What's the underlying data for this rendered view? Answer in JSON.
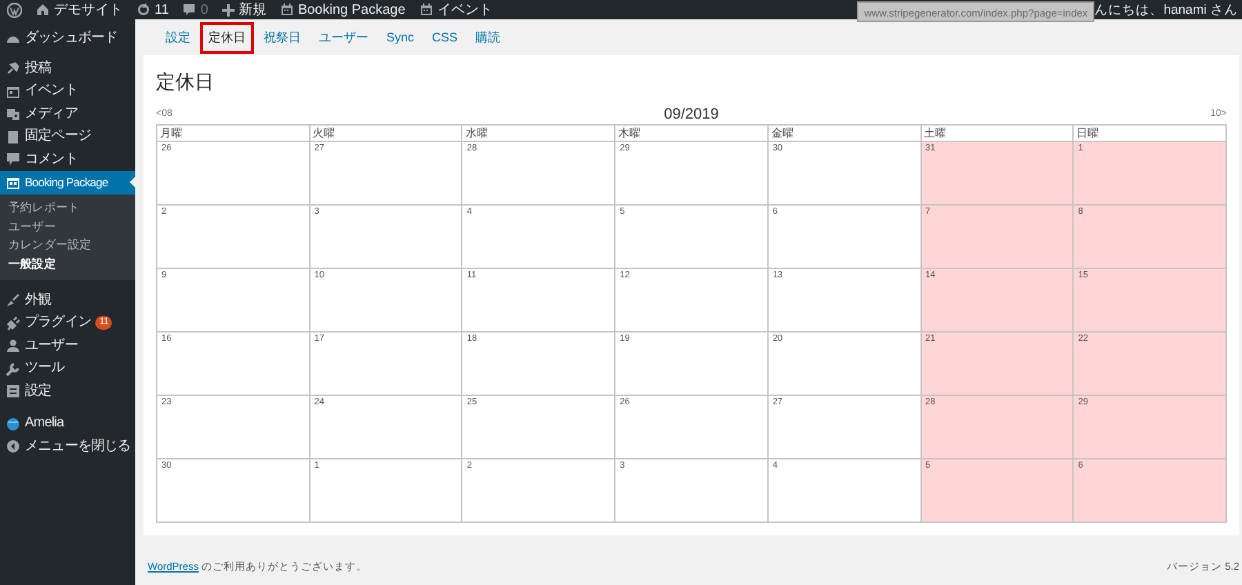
{
  "admin_bar": {
    "items": [
      {
        "kind": "logo"
      },
      {
        "kind": "home",
        "label": "デモサイト"
      },
      {
        "kind": "updates",
        "label": "11"
      },
      {
        "kind": "comments",
        "label": "0"
      },
      {
        "kind": "new",
        "label": "新規"
      },
      {
        "kind": "calendar",
        "label": "Booking Package"
      },
      {
        "kind": "calendar",
        "label": "イベント"
      }
    ],
    "greeting": "んにちは、hanami さん",
    "tooltip": "www.stripegenerator.com/index.php?page=index"
  },
  "sidebar": {
    "items": [
      {
        "label": "ダッシュボード",
        "selected": false
      },
      {
        "label": "投稿",
        "selected": false
      },
      {
        "label": "イベント",
        "selected": false
      },
      {
        "label": "メディア",
        "selected": false
      },
      {
        "label": "固定ページ",
        "selected": false
      },
      {
        "label": "コメント",
        "selected": false
      },
      {
        "label": "Booking Package",
        "selected": true,
        "children": [
          {
            "label": "予約レポート",
            "selected": false
          },
          {
            "label": "ユーザー",
            "selected": false
          },
          {
            "label": "カレンダー設定",
            "selected": false
          },
          {
            "label": "一般設定",
            "selected": true
          }
        ]
      },
      {
        "label": "外観",
        "selected": false
      },
      {
        "label": "プラグイン",
        "selected": false,
        "badge": "11"
      },
      {
        "label": "ユーザー",
        "selected": false
      },
      {
        "label": "ツール",
        "selected": false
      },
      {
        "label": "設定",
        "selected": false
      },
      {
        "label": "Amelia",
        "selected": false
      },
      {
        "label": "メニューを閉じる",
        "selected": false
      }
    ]
  },
  "tabs": [
    {
      "label": "設定",
      "selected": false
    },
    {
      "label": "定休日",
      "selected": true
    },
    {
      "label": "祝祭日",
      "selected": false
    },
    {
      "label": "ユーザー",
      "selected": false
    },
    {
      "label": "Sync",
      "selected": false
    },
    {
      "label": "CSS",
      "selected": false
    },
    {
      "label": "購読",
      "selected": false
    }
  ],
  "heading": "定休日",
  "calendar": {
    "prev": "<08",
    "month": "09/2019",
    "next": "10>",
    "weekdays": [
      "月曜",
      "火曜",
      "水曜",
      "木曜",
      "金曜",
      "土曜",
      "日曜"
    ],
    "weeks": [
      [
        {
          "day": "26",
          "closed": false
        },
        {
          "day": "27",
          "closed": false
        },
        {
          "day": "28",
          "closed": false
        },
        {
          "day": "29",
          "closed": false
        },
        {
          "day": "30",
          "closed": false
        },
        {
          "day": "31",
          "closed": true
        },
        {
          "day": "1",
          "closed": true
        }
      ],
      [
        {
          "day": "2",
          "closed": false
        },
        {
          "day": "3",
          "closed": false
        },
        {
          "day": "4",
          "closed": false
        },
        {
          "day": "5",
          "closed": false
        },
        {
          "day": "6",
          "closed": false
        },
        {
          "day": "7",
          "closed": true
        },
        {
          "day": "8",
          "closed": true
        }
      ],
      [
        {
          "day": "9",
          "closed": false
        },
        {
          "day": "10",
          "closed": false
        },
        {
          "day": "11",
          "closed": false
        },
        {
          "day": "12",
          "closed": false
        },
        {
          "day": "13",
          "closed": false
        },
        {
          "day": "14",
          "closed": true
        },
        {
          "day": "15",
          "closed": true
        }
      ],
      [
        {
          "day": "16",
          "closed": false
        },
        {
          "day": "17",
          "closed": false
        },
        {
          "day": "18",
          "closed": false
        },
        {
          "day": "19",
          "closed": false
        },
        {
          "day": "20",
          "closed": false
        },
        {
          "day": "21",
          "closed": true
        },
        {
          "day": "22",
          "closed": true
        }
      ],
      [
        {
          "day": "23",
          "closed": false
        },
        {
          "day": "24",
          "closed": false
        },
        {
          "day": "25",
          "closed": false
        },
        {
          "day": "26",
          "closed": false
        },
        {
          "day": "27",
          "closed": false
        },
        {
          "day": "28",
          "closed": true
        },
        {
          "day": "29",
          "closed": true
        }
      ],
      [
        {
          "day": "30",
          "closed": false
        },
        {
          "day": "1",
          "closed": false
        },
        {
          "day": "2",
          "closed": false
        },
        {
          "day": "3",
          "closed": false
        },
        {
          "day": "4",
          "closed": false
        },
        {
          "day": "5",
          "closed": true
        },
        {
          "day": "6",
          "closed": true
        }
      ]
    ]
  },
  "footer": {
    "link": "WordPress",
    "text": "のご利用ありがとうございます。",
    "version": "バージョン 5.2"
  }
}
